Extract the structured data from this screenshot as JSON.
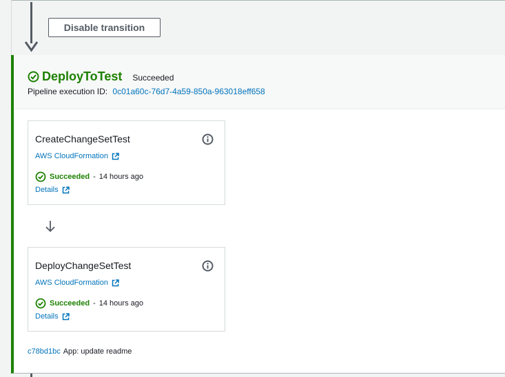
{
  "transition": {
    "disable_label": "Disable transition"
  },
  "stage": {
    "name": "DeployToTest",
    "status": "Succeeded",
    "execution_label": "Pipeline execution ID:",
    "execution_id": "0c01a60c-76d7-4a59-850a-963018eff658"
  },
  "actions": [
    {
      "name": "CreateChangeSetTest",
      "provider": "AWS CloudFormation",
      "status": "Succeeded",
      "separator": "-",
      "time": "14 hours ago",
      "details_label": "Details"
    },
    {
      "name": "DeployChangeSetTest",
      "provider": "AWS CloudFormation",
      "status": "Succeeded",
      "separator": "-",
      "time": "14 hours ago",
      "details_label": "Details"
    }
  ],
  "commit": {
    "id": "c78bd1bc",
    "message": "App: update readme"
  },
  "colors": {
    "success": "#1d8102",
    "link": "#0073bb",
    "text": "#16191f",
    "border": "#d5dbdb"
  },
  "icons": [
    "down-arrow-icon",
    "success-check-icon",
    "info-icon",
    "external-link-icon"
  ]
}
